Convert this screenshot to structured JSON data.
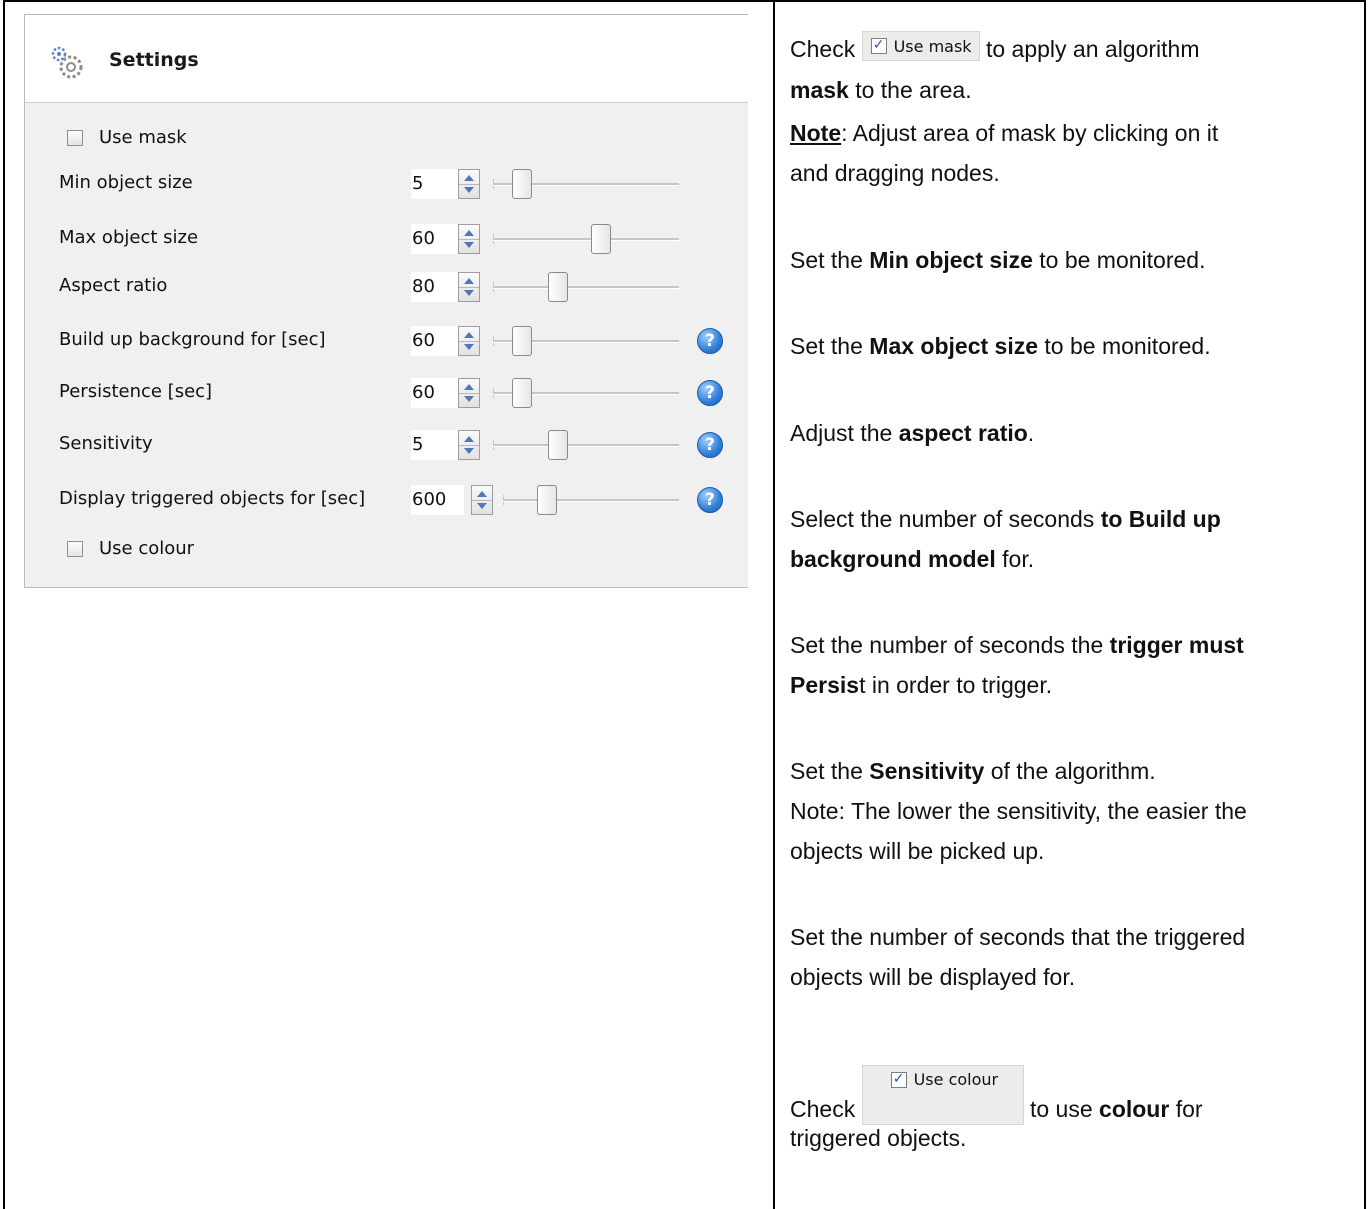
{
  "panel": {
    "title": "Settings",
    "use_mask_label": "Use mask",
    "use_colour_label": "Use colour",
    "rows": [
      {
        "label": "Min object size",
        "value": "5",
        "slider_fraction": 0.07,
        "help": false
      },
      {
        "label": "Max object size",
        "value": "60",
        "slider_fraction": 0.58,
        "help": false
      },
      {
        "label": "Aspect ratio",
        "value": "80",
        "slider_fraction": 0.3,
        "help": false
      },
      {
        "label": "Build up background for [sec]",
        "value": "60",
        "slider_fraction": 0.07,
        "help": true
      },
      {
        "label": "Persistence [sec]",
        "value": "60",
        "slider_fraction": 0.07,
        "help": true
      },
      {
        "label": "Sensitivity",
        "value": "5",
        "slider_fraction": 0.3,
        "help": true
      },
      {
        "label": "Display triggered objects for [sec]",
        "value": "600",
        "slider_fraction": 0.18,
        "help": true
      }
    ]
  },
  "instructions": {
    "p1": {
      "pre": "Check",
      "button": "Use mask",
      "post": "to apply an algorithm",
      "line2_bold": "mask",
      "line2_rest": "to the area."
    },
    "note1": {
      "label": "Note",
      "text": ": Adjust area of mask by clicking on it",
      "line2": "and dragging nodes."
    },
    "p2": {
      "pre": "Set the",
      "bold": "Min object size",
      "post": "to be monitored."
    },
    "p3": {
      "pre": "Set the",
      "bold": "Max object size",
      "post": "to be monitored."
    },
    "p4": {
      "pre": "Adjust the",
      "bold": "aspect ratio",
      "post": "."
    },
    "p5": {
      "line1_pre": "Select the number of seconds",
      "line1_bold": "to Build up",
      "line2_bold": "background model",
      "line2_post": "for."
    },
    "p6": {
      "line1_pre": "Set the number of seconds the",
      "line1_bold": "trigger must",
      "line2_bold": "Persis",
      "line2_post": "t in order to trigger."
    },
    "p7": {
      "pre": "Set the",
      "bold": "Sensitivity",
      "post": "of the algorithm."
    },
    "note2": {
      "line1": "Note: The lower the sensitivity, the easier the",
      "line2": "objects will be picked up."
    },
    "p8": {
      "line1": "Set the number of seconds that the triggered",
      "line2": "objects will be displayed for."
    },
    "p9": {
      "pre": "Check",
      "button": "Use colour",
      "post": "to use",
      "bold": "colour",
      "post2": "for",
      "line2": "triggered objects."
    }
  }
}
